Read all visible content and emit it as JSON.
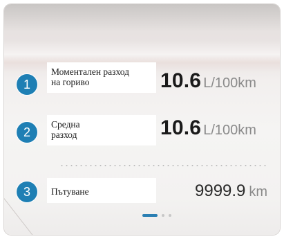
{
  "rows": [
    {
      "number": "1",
      "label_line1": "Моментален разход",
      "label_line2": "на гориво",
      "value": "10.6",
      "unit": "L/100km"
    },
    {
      "number": "2",
      "label_line1": "Средна",
      "label_line2": "разход",
      "value": "10.6",
      "unit": "L/100km"
    },
    {
      "number": "3",
      "label_line1": "Пътуване",
      "value": "9999.9",
      "unit": "km"
    }
  ],
  "pager": {
    "pages": 3,
    "active_index": 0
  },
  "colors": {
    "accent": "#1e7fb4",
    "pager_active": "#2a7fb3",
    "unit_text": "#8a8a8a"
  }
}
